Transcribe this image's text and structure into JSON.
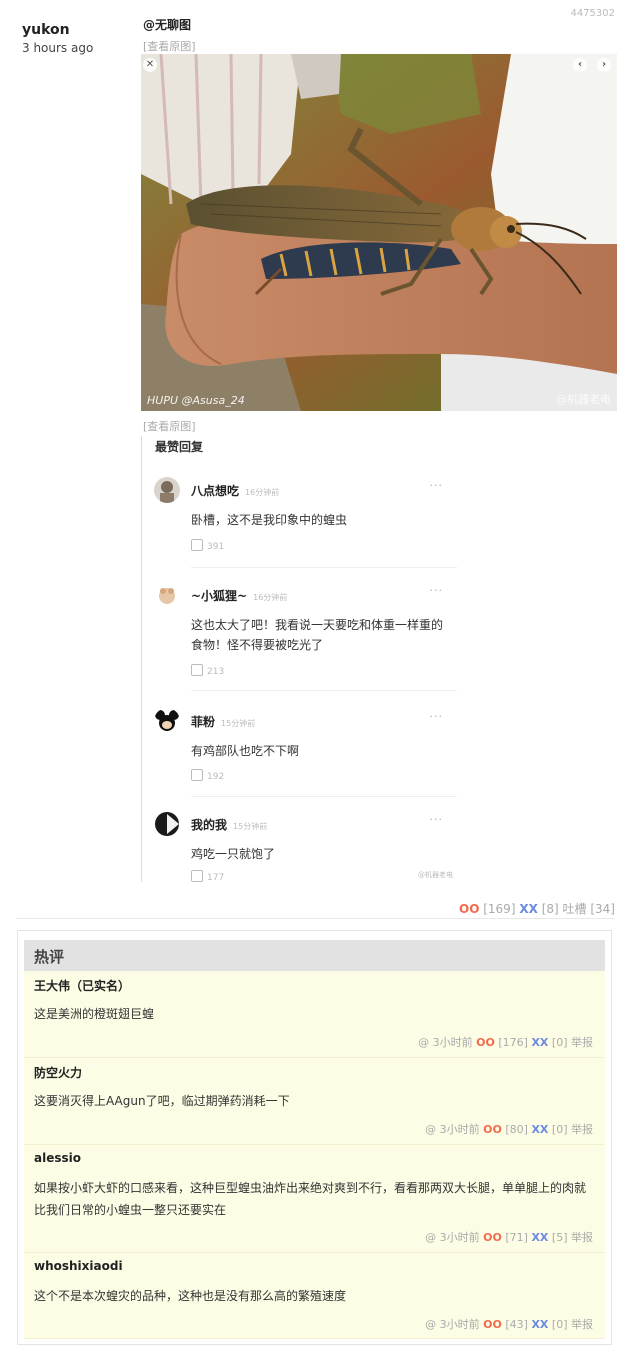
{
  "post": {
    "id": "4475302",
    "author": "yukon",
    "time": "3 hours ago",
    "mention": "@无聊图",
    "view_original": "[查看原图]",
    "photo_watermark_left": "HUPU @Asusa_24",
    "photo_watermark_right": "@机器老电"
  },
  "screenshot": {
    "title": "最赞回复",
    "weibo_mark": "@机器老电",
    "replies": [
      {
        "name": "八点想吃",
        "time": "16分钟前",
        "text": "卧槽，这不是我印象中的蝗虫",
        "likes": "391",
        "more": "···"
      },
      {
        "name": "~小狐狸~",
        "time": "16分钟前",
        "text": "这也太大了吧！我看说一天要吃和体重一样重的食物！怪不得要被吃光了",
        "likes": "213",
        "more": "···"
      },
      {
        "name": "菲粉",
        "time": "15分钟前",
        "text": "有鸡部队也吃不下啊",
        "likes": "192",
        "more": "···"
      },
      {
        "name": "我的我",
        "time": "15分钟前",
        "text": "鸡吃一只就饱了",
        "likes": "177",
        "more": "···"
      }
    ]
  },
  "votes": {
    "oo_label": "OO",
    "oo_count": "[169]",
    "xx_label": "XX",
    "xx_count": "[8]",
    "tucao_label": "吐槽",
    "tucao_count": "[34]"
  },
  "hot": {
    "title": "热评",
    "comments": [
      {
        "name": "王大伟（已实名）",
        "text": "这是美洲的橙斑翅巨蝗",
        "meta_at": "@",
        "time": "3小时前",
        "oo": "OO",
        "oo_count": "[176]",
        "xx": "XX",
        "xx_count": "[0]",
        "report": "举报"
      },
      {
        "name": "防空火力",
        "text": "这要消灭得上AAgun了吧，临过期弹药消耗一下",
        "meta_at": "@",
        "time": "3小时前",
        "oo": "OO",
        "oo_count": "[80]",
        "xx": "XX",
        "xx_count": "[0]",
        "report": "举报"
      },
      {
        "name": "alessio",
        "text": "如果按小虾大虾的口感来看，这种巨型蝗虫油炸出来绝对爽到不行，看看那两双大长腿，单单腿上的肉就比我们日常的小蝗虫一整只还要实在",
        "meta_at": "@",
        "time": "3小时前",
        "oo": "OO",
        "oo_count": "[71]",
        "xx": "XX",
        "xx_count": "[5]",
        "report": "举报"
      },
      {
        "name": "whoshixiaodi",
        "text": "这个不是本次蝗灾的品种，这种也是没有那么高的繁殖速度",
        "meta_at": "@",
        "time": "3小时前",
        "oo": "OO",
        "oo_count": "[43]",
        "xx": "XX",
        "xx_count": "[0]",
        "report": "举报"
      }
    ]
  }
}
